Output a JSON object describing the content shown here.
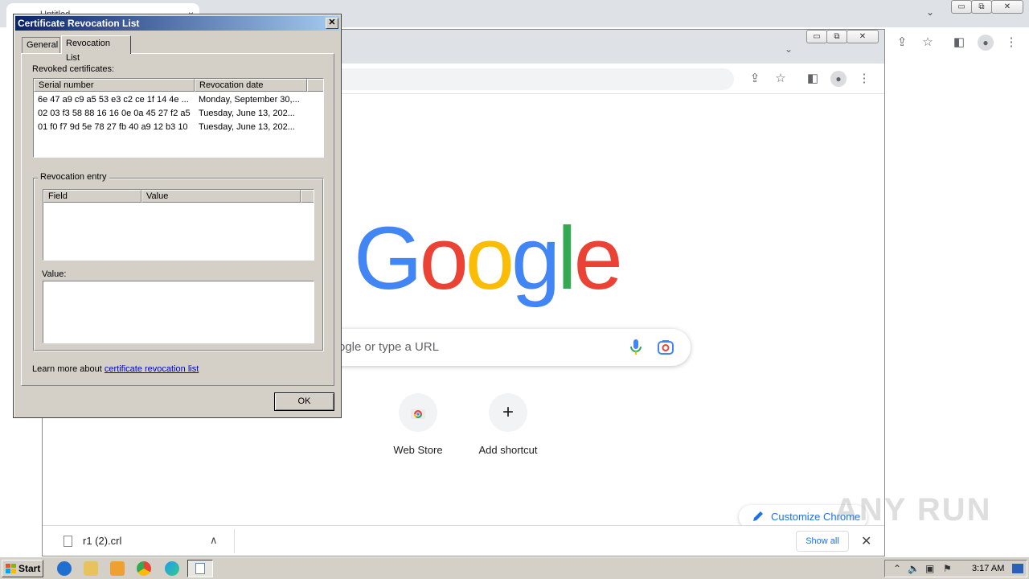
{
  "back_window": {
    "tab_title": "Untitled",
    "tab_close": "×",
    "tab_search": "⌄",
    "win_minimize": "▭",
    "win_restore": "⧉",
    "win_close": "✕"
  },
  "mid_window": {
    "dropdown": "⌄",
    "win_minimize": "▭",
    "win_restore": "⧉",
    "win_close": "✕"
  },
  "toolbar_icons": {
    "share": "⇪",
    "bookmark": "☆",
    "sidepanel": "◧",
    "profile": "●",
    "menu": "⋮"
  },
  "google_logo": [
    "G",
    "o",
    "o",
    "g",
    "l",
    "e"
  ],
  "colors": {
    "google_blue": "#4285f4",
    "google_red": "#ea4335",
    "google_yellow": "#fbbc05",
    "google_green": "#34a853",
    "link_blue": "#1a73e8",
    "dialog_title_start": "#0a246a"
  },
  "search": {
    "placeholder": "ogle or type a URL"
  },
  "shortcuts": [
    {
      "label": "Web Store",
      "icon": "chrome-webstore-icon"
    },
    {
      "label": "Add shortcut",
      "icon": "+"
    }
  ],
  "customize_chrome": "Customize Chrome",
  "download_bar": {
    "file_name": "r1 (2).crl",
    "chevron": "∧",
    "show_all": "Show all",
    "close": "✕"
  },
  "watermark": "ANY RUN",
  "dialog": {
    "title": "Certificate Revocation List",
    "close": "✕",
    "tabs": [
      "General",
      "Revocation List"
    ],
    "active_tab": "Revocation List",
    "revoked_label": "Revoked certificates:",
    "columns": [
      "Serial number",
      "Revocation date"
    ],
    "rows": [
      {
        "serial": "6e 47 a9 c9 a5 53 e3 c2 ce 1f 14 4e ...",
        "date": "Monday, September 30,..."
      },
      {
        "serial": "02 03 f3 58 88 16 16 0e 0a 45 27 f2 a5",
        "date": "Tuesday, June 13, 202..."
      },
      {
        "serial": "01 f0 f7 9d 5e 78 27 fb 40 a9 12 b3 10",
        "date": "Tuesday, June 13, 202..."
      }
    ],
    "entry_group_label": "Revocation entry",
    "entry_columns": [
      "Field",
      "Value"
    ],
    "value_label": "Value:",
    "learn_more_prefix": "Learn more about ",
    "learn_more_link": "certificate revocation list",
    "ok": "OK"
  },
  "taskbar": {
    "start": "Start",
    "clock": "3:17 AM"
  }
}
